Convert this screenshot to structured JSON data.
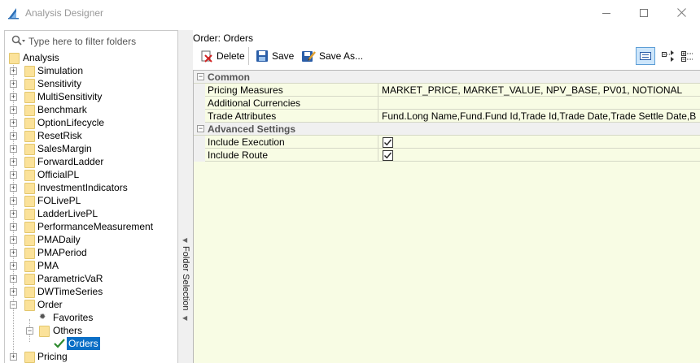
{
  "window": {
    "title": "Analysis Designer",
    "controls": [
      "minimize",
      "maximize",
      "close"
    ]
  },
  "filter": {
    "placeholder": "Type here to filter folders",
    "value": ""
  },
  "tree": {
    "root": "Analysis",
    "items": [
      "Simulation",
      "Sensitivity",
      "MultiSensitivity",
      "Benchmark",
      "OptionLifecycle",
      "ResetRisk",
      "SalesMargin",
      "ForwardLadder",
      "OfficialPL",
      "InvestmentIndicators",
      "FOLivePL",
      "LadderLivePL",
      "PerformanceMeasurement",
      "PMADaily",
      "PMAPeriod",
      "PMA",
      "ParametricVaR",
      "DWTimeSeries"
    ],
    "order": {
      "label": "Order",
      "favorites": "Favorites",
      "others": "Others",
      "selected": "Orders"
    },
    "after": "Pricing"
  },
  "splitter": {
    "label": "Folder Selection"
  },
  "panel": {
    "title": "Order: Orders"
  },
  "toolbar": {
    "delete": "Delete",
    "save": "Save",
    "save_as": "Save As..."
  },
  "grid": {
    "common_label": "Common",
    "advanced_label": "Advanced Settings",
    "common": [
      {
        "name": "Pricing Measures",
        "value": "MARKET_PRICE, MARKET_VALUE, NPV_BASE, PV01, NOTIONAL"
      },
      {
        "name": "Additional Currencies",
        "value": ""
      },
      {
        "name": "Trade Attributes",
        "value": "Fund.Long Name,Fund.Fund Id,Trade Id,Trade Date,Trade Settle Date,Bund..."
      }
    ],
    "advanced": [
      {
        "name": "Include Execution",
        "checked": true
      },
      {
        "name": "Include Route",
        "checked": true
      }
    ]
  },
  "colors": {
    "grid_bg": "#f8fce4",
    "selection": "#0b6fc6",
    "folder": "#fbe29a"
  }
}
